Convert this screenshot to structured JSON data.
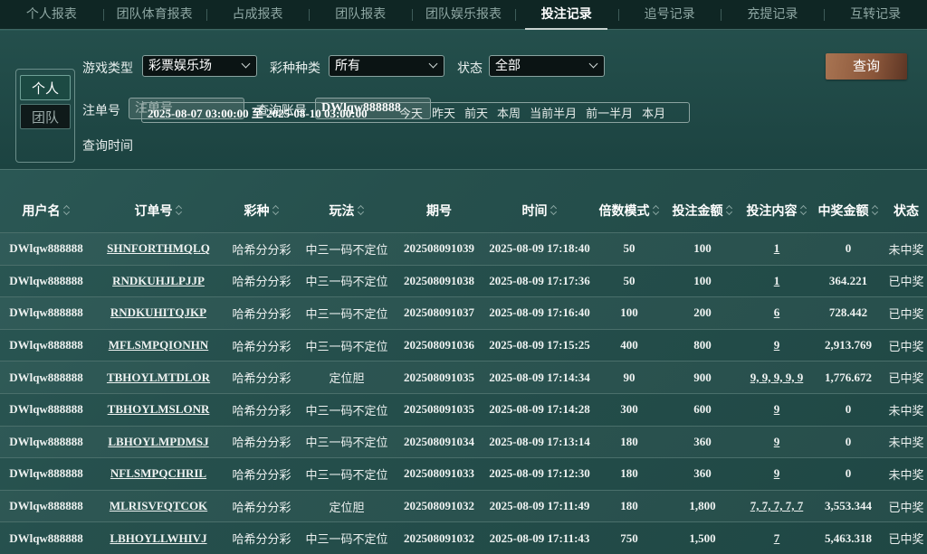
{
  "tabs": [
    "个人报表",
    "团队体育报表",
    "占成报表",
    "团队报表",
    "团队娱乐报表",
    "投注记录",
    "追号记录",
    "充提记录",
    "互转记录"
  ],
  "active_tab": 5,
  "filter": {
    "scope_personal": "个人",
    "scope_team": "团队",
    "game_type_label": "游戏类型",
    "game_type_value": "彩票娱乐场",
    "lottery_label": "彩种种类",
    "lottery_value": "所有",
    "status_label": "状态",
    "status_value": "全部",
    "order_label": "注单号",
    "order_placeholder": "注单号",
    "account_label": "查询账号",
    "account_value": "DWlqw888888",
    "time_label": "查询时间",
    "time_range": "2025-08-07 03:00:00 至 2025-08-10 03:00:00",
    "quick": [
      "今天",
      "昨天",
      "前天",
      "本周",
      "当前半月",
      "前一半月",
      "本月"
    ],
    "query_button": "查询"
  },
  "table": {
    "headers": [
      "用户名",
      "订单号",
      "彩种",
      "玩法",
      "期号",
      "时间",
      "倍数模式",
      "投注金额",
      "投注内容",
      "中奖金额",
      "状态"
    ],
    "sortable": [
      true,
      true,
      true,
      true,
      false,
      true,
      true,
      true,
      true,
      true,
      false
    ],
    "rows": [
      [
        "DWlqw888888",
        "SHNFORTHMQLQ",
        "哈希分分彩",
        "中三一码不定位",
        "202508091039",
        "2025-08-09 17:18:40",
        "50",
        "100",
        "1",
        "0",
        "未中奖"
      ],
      [
        "DWlqw888888",
        "RNDKUHJLPJJP",
        "哈希分分彩",
        "中三一码不定位",
        "202508091038",
        "2025-08-09 17:17:36",
        "50",
        "100",
        "1",
        "364.221",
        "已中奖"
      ],
      [
        "DWlqw888888",
        "RNDKUHITQJKP",
        "哈希分分彩",
        "中三一码不定位",
        "202508091037",
        "2025-08-09 17:16:40",
        "100",
        "200",
        "6",
        "728.442",
        "已中奖"
      ],
      [
        "DWlqw888888",
        "MFLSMPQIONHN",
        "哈希分分彩",
        "中三一码不定位",
        "202508091036",
        "2025-08-09 17:15:25",
        "400",
        "800",
        "9",
        "2,913.769",
        "已中奖"
      ],
      [
        "DWlqw888888",
        "TBHOYLMTDLOR",
        "哈希分分彩",
        "定位胆",
        "202508091035",
        "2025-08-09 17:14:34",
        "90",
        "900",
        "9, 9, 9, 9, 9",
        "1,776.672",
        "已中奖"
      ],
      [
        "DWlqw888888",
        "TBHOYLMSLONR",
        "哈希分分彩",
        "中三一码不定位",
        "202508091035",
        "2025-08-09 17:14:28",
        "300",
        "600",
        "9",
        "0",
        "未中奖"
      ],
      [
        "DWlqw888888",
        "LBHOYLMPDMSJ",
        "哈希分分彩",
        "中三一码不定位",
        "202508091034",
        "2025-08-09 17:13:14",
        "180",
        "360",
        "9",
        "0",
        "未中奖"
      ],
      [
        "DWlqw888888",
        "NFLSMPQCHRIL",
        "哈希分分彩",
        "中三一码不定位",
        "202508091033",
        "2025-08-09 17:12:30",
        "180",
        "360",
        "9",
        "0",
        "未中奖"
      ],
      [
        "DWlqw888888",
        "MLRISVFQTCOK",
        "哈希分分彩",
        "定位胆",
        "202508091032",
        "2025-08-09 17:11:49",
        "180",
        "1,800",
        "7, 7, 7, 7, 7",
        "3,553.344",
        "已中奖"
      ],
      [
        "DWlqw888888",
        "LBHOYLLWHIVJ",
        "哈希分分彩",
        "中三一码不定位",
        "202508091032",
        "2025-08-09 17:11:43",
        "750",
        "1,500",
        "7",
        "5,463.318",
        "已中奖"
      ]
    ]
  }
}
